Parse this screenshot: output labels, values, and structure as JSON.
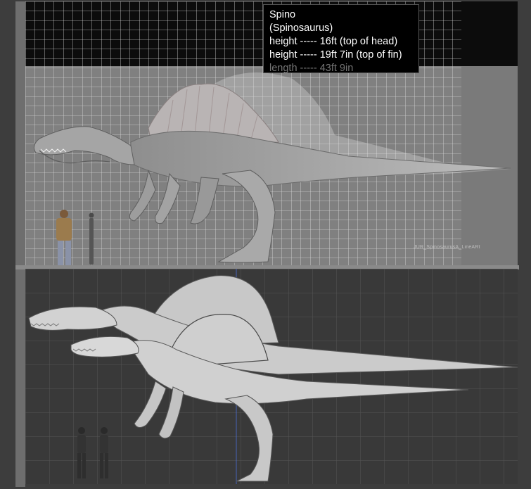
{
  "upper": {
    "info_box": {
      "name": "Spino",
      "species": "(Spinosaurus)",
      "lines": [
        "height ----- 16ft (top of head)",
        "height ----- 19ft 7in (top of fin)",
        "length ----- 43ft 9in"
      ]
    },
    "watermark": "JUR_SpinosaurusA_LineARt"
  },
  "colors": {
    "background": "#3d3d3d",
    "upper_grid_bg": "#7c7c7c",
    "upper_top_band": "#000000",
    "lower_grid_bg": "#3a3a3a",
    "model_gray": "#c9c9c9",
    "accent_line": "#4a6fd6"
  }
}
